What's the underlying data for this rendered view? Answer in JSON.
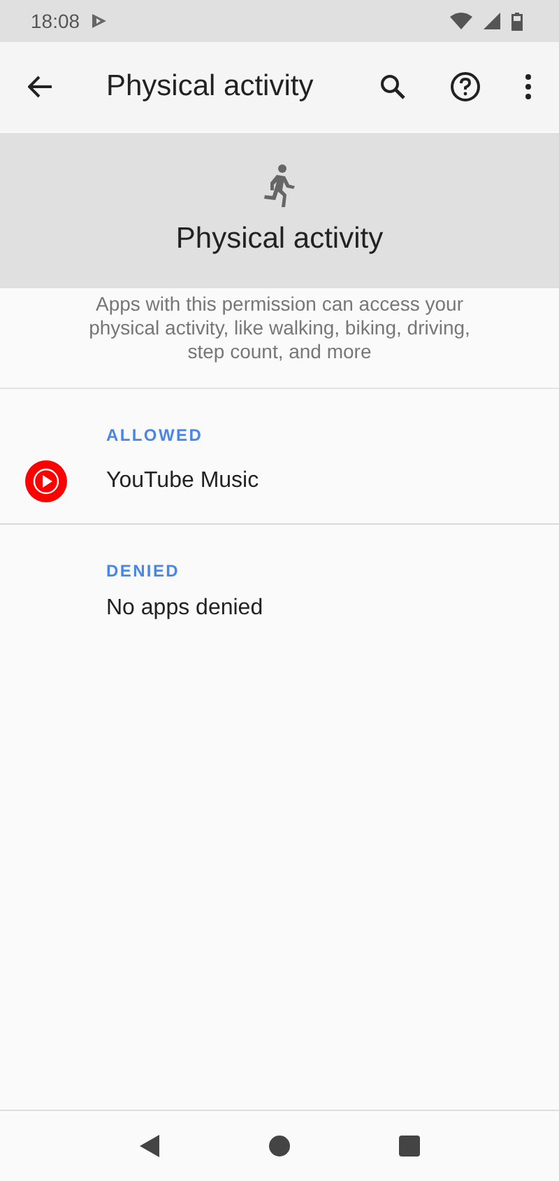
{
  "status_bar": {
    "time": "18:08"
  },
  "app_bar": {
    "title": "Physical activity"
  },
  "header": {
    "title": "Physical activity",
    "description": "Apps with this permission can access your physical activity, like walking, biking, driving, step count, and more"
  },
  "sections": [
    {
      "title": "ALLOWED",
      "items": [
        {
          "kind": "app",
          "label": "YouTube Music"
        }
      ]
    },
    {
      "title": "DENIED",
      "items": [
        {
          "kind": "empty",
          "label": "No apps denied"
        }
      ]
    }
  ]
}
